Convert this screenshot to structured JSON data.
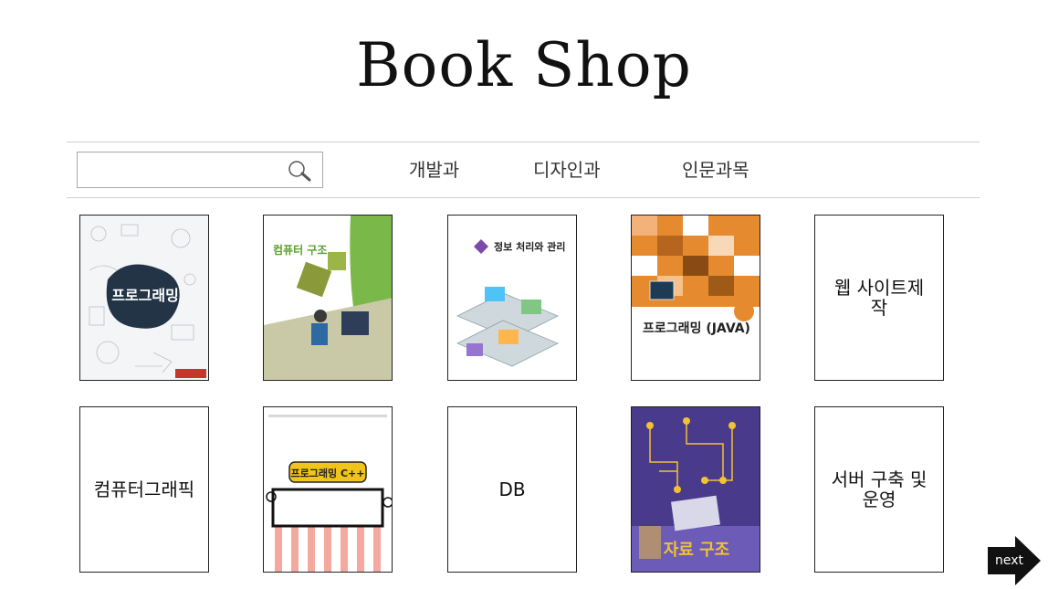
{
  "header": {
    "title": "Book Shop"
  },
  "search": {
    "placeholder": "",
    "value": ""
  },
  "nav": {
    "items": [
      "개발과",
      "디자인과",
      "인문과목"
    ]
  },
  "books": [
    {
      "cover_text": "프로그래밍"
    },
    {
      "cover_text": "컴퓨터 구조"
    },
    {
      "cover_text": "정보 처리와 관리"
    },
    {
      "cover_text": "프로그래밍 (JAVA)"
    },
    {
      "label": "웹 사이트제작"
    },
    {
      "label": "컴퓨터그래픽"
    },
    {
      "cover_text": "프로그래밍 C++"
    },
    {
      "label": "DB"
    },
    {
      "cover_text": "자료 구조"
    },
    {
      "label": "서버 구축 및 운영"
    }
  ],
  "pager": {
    "next_label": "next"
  }
}
